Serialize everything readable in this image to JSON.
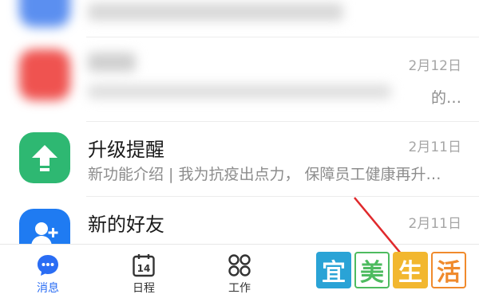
{
  "colors": {
    "accent": "#2a6df4",
    "red_avatar": "#ef5350",
    "green_avatar": "#2eb872",
    "blue_avatar": "#1f7bf2"
  },
  "messages": [
    {
      "title": "",
      "preview": "",
      "date": "",
      "icon": "blurred-avatar-icon",
      "blurred": true
    },
    {
      "title": "",
      "preview": "",
      "date": "2月12日",
      "preview_tail": "的…",
      "icon": "blurred-red-avatar-icon",
      "blurred": true
    },
    {
      "title": "升级提醒",
      "preview": "新功能介绍 | 我为抗疫出点力， 保障员工健康再升…",
      "date": "2月11日",
      "icon": "arrow-up-icon",
      "blurred": false
    },
    {
      "title": "新的好友",
      "preview": "",
      "date": "2月11日",
      "icon": "add-user-icon",
      "blurred": false
    }
  ],
  "tabbar": {
    "tabs": [
      {
        "label": "消息",
        "icon": "chat-bubble-icon",
        "active": true
      },
      {
        "label": "日程",
        "icon": "calendar-icon",
        "active": false,
        "calendar_day": "14"
      },
      {
        "label": "工作",
        "icon": "grid-apps-icon",
        "active": false
      },
      {
        "label": "",
        "icon": "address-book-icon",
        "active": false
      },
      {
        "label": "",
        "icon": "me-icon",
        "active": false
      }
    ]
  },
  "watermark": {
    "chars": [
      "宜",
      "美",
      "生",
      "活"
    ],
    "colors": [
      "#2aa3d6",
      "#4dbb5f",
      "#f2b72f",
      "#f08a2c"
    ]
  }
}
